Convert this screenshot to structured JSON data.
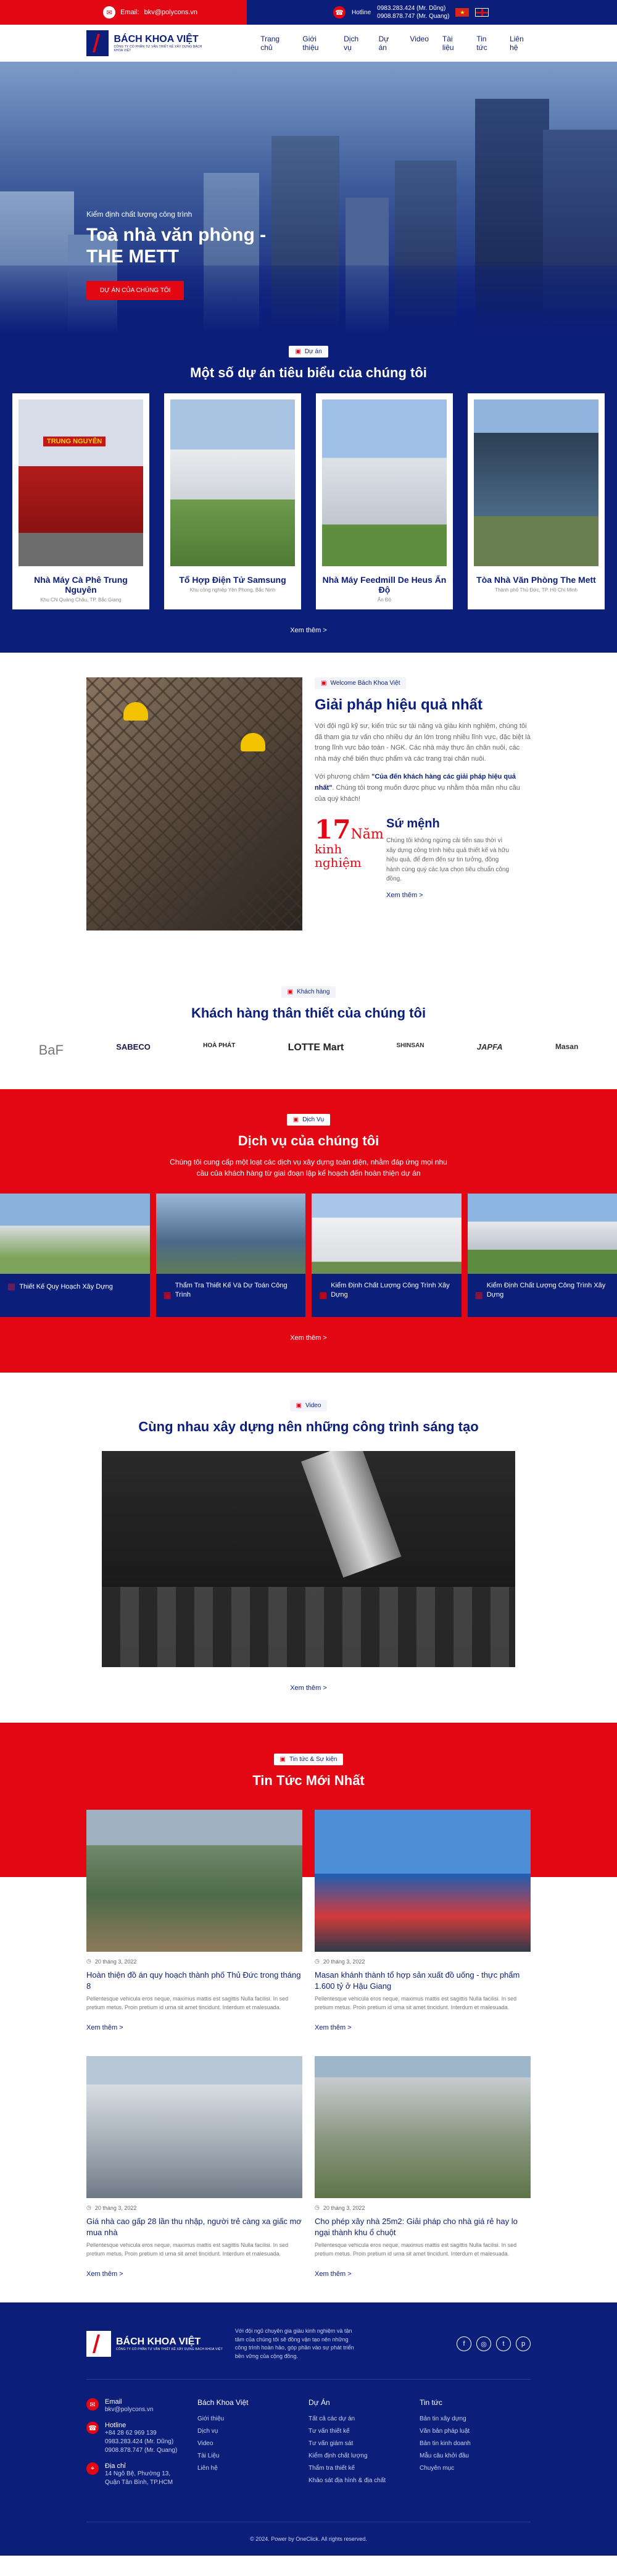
{
  "topbar": {
    "email_label": "Email:",
    "email": "bkv@polycons.vn",
    "hotline_label": "Hotline",
    "hotline_1": "0983.283.424 (Mr. Dũng)",
    "hotline_2": "0908.878.747 (Mr. Quang)"
  },
  "header": {
    "brand": "BÁCH KHOA VIỆT",
    "slogan": "CÔNG TY CỔ PHẦN TƯ VẤN THIẾT KẾ XÂY DỰNG BÁCH KHOA VIỆT",
    "nav": [
      "Trang chủ",
      "Giới thiệu",
      "Dịch vụ",
      "Dự án",
      "Video",
      "Tài liệu",
      "Tin tức",
      "Liên hệ"
    ]
  },
  "hero": {
    "subtitle": "Kiểm định chất lượng công trình",
    "title": "Toà nhà văn phòng - THE METT",
    "button": "DỰ ÁN CỦA CHÚNG TÔI"
  },
  "projects": {
    "tag": "Dự án",
    "title": "Một số dự án tiêu biểu của chúng tôi",
    "items": [
      {
        "name": "Nhà Máy Cà Phê Trung Nguyên",
        "addr": "Khu CN Quảng Châu, TP. Bắc Giang"
      },
      {
        "name": "Tổ Hợp Điện Tử Samsung",
        "addr": "Khu công nghiệp Yên Phong, Bắc Ninh"
      },
      {
        "name": "Nhà Máy Feedmill De Heus Ấn Độ",
        "addr": "Ấn Độ"
      },
      {
        "name": "Tòa Nhà Văn Phòng The Mett",
        "addr": "Thành phố Thủ Đức, TP. Hồ Chí Minh"
      }
    ],
    "more": "Xem thêm >"
  },
  "welcome": {
    "tag": "Welcome Bách Khoa Việt",
    "title": "Giải pháp hiệu quả nhất",
    "p1": "Với đội ngũ kỹ sư, kiến trúc sư tài năng và giàu kinh nghiệm, chúng tôi đã tham gia tư vấn cho nhiều dự án lớn trong nhiều lĩnh vực, đặc biệt là trong lĩnh vực bảo toàn - NGK. Các nhà máy thực ăn chăn nuôi, các nhà máy chế biến thực phẩm và các trang trại chăn nuôi.",
    "p2_pre": "Với phương châm ",
    "p2_bold": "\"Của đến khách hàng các giải pháp hiệu quả nhất\"",
    "p2_post": ". Chúng tôi trong muốn được phục vụ nhằm thỏa mãn nhu cầu của quý khách!",
    "years": "17",
    "years_label": "Năm",
    "years_sub": "kinh nghiệm",
    "mission_title": "Sứ mệnh",
    "mission_text": "Chúng tôi không ngừng cải tiến sau thời vì xây dựng công trình hiệu quả thiết kế và hữu hiệu quả, để đem đến sự tin tưởng, đồng hành cùng quý các lựa chọn tiêu chuẩn công đồng.",
    "more": "Xem thêm >"
  },
  "clients": {
    "tag": "Khách hàng",
    "title": "Khách hàng thân thiết của chúng tôi",
    "logos": [
      "BaF",
      "SABECO",
      "HOÀ PHÁT",
      "LOTTE Mart",
      "SHINSAN",
      "JAPFA",
      "Masan"
    ]
  },
  "services": {
    "tag": "Dịch Vụ",
    "title": "Dịch vụ của chúng tôi",
    "desc": "Chúng tôi cung cấp một loạt các dịch vụ xây dựng toàn diện, nhằm đáp ứng mọi nhu cầu của khách hàng từ giai đoạn lập kế hoạch đến hoàn thiện dự án",
    "items": [
      {
        "name": "Thiết Kế Quy Hoạch Xây Dựng"
      },
      {
        "name": "Thẩm Tra Thiết Kế Và Dự Toán Công Trình"
      },
      {
        "name": "Kiểm Định Chất Lượng Công Trình Xây Dựng"
      },
      {
        "name": "Kiểm Định Chất Lượng Công Trình Xây Dựng"
      }
    ],
    "more": "Xem thêm >"
  },
  "video": {
    "tag": "Video",
    "title": "Cùng nhau xây dựng nên những công trình sáng tạo",
    "more": "Xem thêm >"
  },
  "news": {
    "tag": "Tin tức & Sự kiện",
    "title": "Tin Tức Mới Nhất",
    "items": [
      {
        "date": "20 tháng 3, 2022",
        "title": "Hoàn thiện đồ án quy hoạch thành phố Thủ Đức trong tháng 8",
        "excerpt": "Pellentesque vehicula eros neque, maximus mattis est sagittis Nulla facilisi. In sed pretium metus. Proin pretium id urna sit amet tincidunt. Interdum et malesuada.",
        "more": "Xem thêm >"
      },
      {
        "date": "20 tháng 3, 2022",
        "title": "Masan khánh thành tổ hợp sản xuất đồ uống - thực phẩm 1.600 tỷ ở Hậu Giang",
        "excerpt": "Pellentesque vehicula eros neque, maximus mattis est sagittis Nulla facilisi. In sed pretium metus. Proin pretium id urna sit amet tincidunt. Interdum et malesuada.",
        "more": "Xem thêm >"
      },
      {
        "date": "20 tháng 3, 2022",
        "title": "Giá nhà cao gấp 28 lần thu nhập, người trẻ càng xa giấc mơ mua nhà",
        "excerpt": "Pellentesque vehicula eros neque, maximus mattis est sagittis Nulla facilisi. In sed pretium metus. Proin pretium id urna sit amet tincidunt. Interdum et malesuada.",
        "more": "Xem thêm >"
      },
      {
        "date": "20 tháng 3, 2022",
        "title": "Cho phép xây nhà 25m2: Giải pháp cho nhà giá rẻ hay lo ngại thành khu ổ chuột",
        "excerpt": "Pellentesque vehicula eros neque, maximus mattis est sagittis Nulla facilisi. In sed pretium metus. Proin pretium id urna sit amet tincidunt. Interdum et malesuada.",
        "more": "Xem thêm >"
      }
    ]
  },
  "footer": {
    "brand": "BÁCH KHOA VIỆT",
    "slogan": "CÔNG TY CỔ PHẦN TƯ VẤN THIẾT KẾ XÂY DỰNG BÁCH KHOA VIỆT",
    "desc": "Với đội ngũ chuyên gia giàu kinh nghiệm và tận tâm của chúng tôi sẽ đồng vận tạo nên những công trình hoàn hảo, góp phần vào sự phát triển bền vững của cộng đồng.",
    "contact": {
      "email_label": "Email",
      "email": "bkv@polycons.vn",
      "hotline_label": "Hotline",
      "hotline_1": "+84 28 62 969 139",
      "hotline_2": "0983.283.424 (Mr. Dũng)",
      "hotline_3": "0908.878.747 (Mr. Quang)",
      "address_label": "Địa chỉ",
      "address": "14 Ngô Bệ, Phường 13, Quận Tân Bình, TP.HCM"
    },
    "col1": {
      "title": "Bách Khoa Việt",
      "items": [
        "Giới thiệu",
        "Dịch vụ",
        "Video",
        "Tài Liệu",
        "Liên hệ"
      ]
    },
    "col2": {
      "title": "Dự Án",
      "items": [
        "Tất cả các dự án",
        "Tư vấn thiết kế",
        "Tư vấn giám sát",
        "Kiểm định chất lượng",
        "Thẩm tra thiết kế",
        "Khảo sát địa hình & địa chất"
      ]
    },
    "col3": {
      "title": "Tin tức",
      "items": [
        "Bản tin xây dựng",
        "Văn bản pháp luật",
        "Bản tin kinh doanh",
        "Mẫu câu khởi đầu",
        "Chuyên mục"
      ]
    },
    "copyright": "© 2024. Power by OneClick. All rights reserved."
  }
}
